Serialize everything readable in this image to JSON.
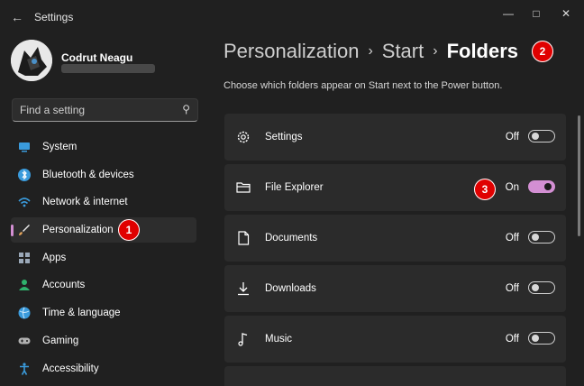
{
  "app": {
    "title": "Settings"
  },
  "user": {
    "name": "Codrut Neagu"
  },
  "search": {
    "placeholder": "Find a setting"
  },
  "sidebar": {
    "items": [
      {
        "label": "System",
        "icon": "system-icon",
        "color": "#3a9bdc"
      },
      {
        "label": "Bluetooth & devices",
        "icon": "bluetooth-icon",
        "color": "#3a9bdc"
      },
      {
        "label": "Network & internet",
        "icon": "wifi-icon",
        "color": "#3a9bdc"
      },
      {
        "label": "Personalization",
        "icon": "brush-icon",
        "color": "#e1a35b",
        "active": true
      },
      {
        "label": "Apps",
        "icon": "apps-icon",
        "color": "#9aa8b8"
      },
      {
        "label": "Accounts",
        "icon": "accounts-icon",
        "color": "#2fb36c"
      },
      {
        "label": "Time & language",
        "icon": "globe-icon",
        "color": "#3a9bdc"
      },
      {
        "label": "Gaming",
        "icon": "gaming-icon",
        "color": "#b0b0b0"
      },
      {
        "label": "Accessibility",
        "icon": "accessibility-icon",
        "color": "#3a9bdc"
      }
    ]
  },
  "breadcrumb": {
    "items": [
      "Personalization",
      "Start",
      "Folders"
    ]
  },
  "page": {
    "description": "Choose which folders appear on Start next to the Power button."
  },
  "folders": [
    {
      "label": "Settings",
      "icon": "gear-icon",
      "state": "Off",
      "on": false
    },
    {
      "label": "File Explorer",
      "icon": "folder-icon",
      "state": "On",
      "on": true
    },
    {
      "label": "Documents",
      "icon": "document-icon",
      "state": "Off",
      "on": false
    },
    {
      "label": "Downloads",
      "icon": "download-icon",
      "state": "Off",
      "on": false
    },
    {
      "label": "Music",
      "icon": "music-icon",
      "state": "Off",
      "on": false
    }
  ],
  "badges": [
    "1",
    "2",
    "3"
  ],
  "colors": {
    "accent": "#d38fd3",
    "badge": "#e00000",
    "background": "#202020",
    "card": "#2b2b2b"
  }
}
